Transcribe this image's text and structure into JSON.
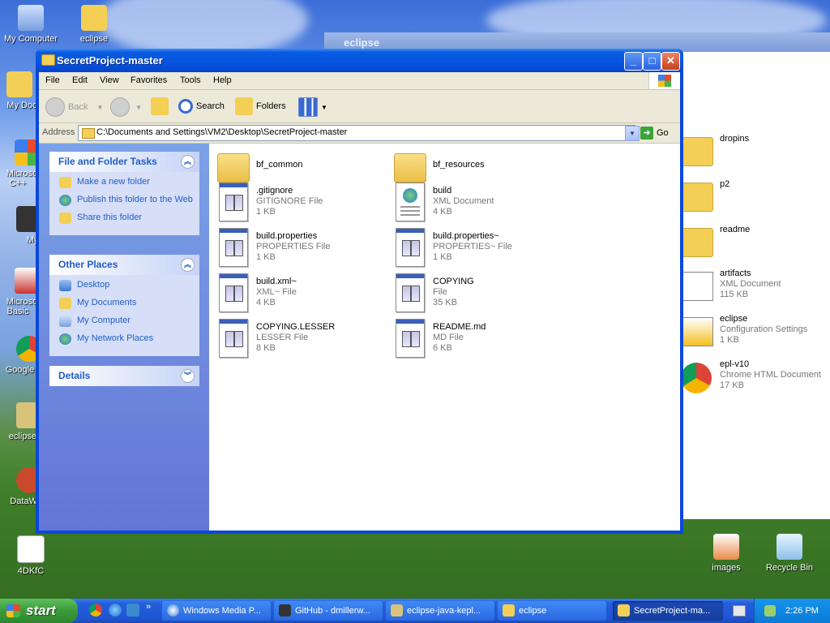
{
  "desktop": {
    "icons_left": [
      "My Computer",
      "eclipse",
      "My Docu",
      "Microsoft C++",
      "Myp",
      "Microsoft Basic",
      "Google C",
      "eclipse-ja",
      "DataWa",
      "4DKfC"
    ],
    "icons_right": [
      "images",
      "Recycle Bin"
    ]
  },
  "background_window": {
    "title": "eclipse",
    "items": [
      {
        "name": "dropins",
        "type": "",
        "size": ""
      },
      {
        "name": "p2",
        "type": "",
        "size": ""
      },
      {
        "name": "readme",
        "type": "",
        "size": ""
      },
      {
        "name": "artifacts",
        "type": "XML Document",
        "size": "115 KB"
      },
      {
        "name": "eclipse",
        "type": "Configuration Settings",
        "size": "1 KB"
      },
      {
        "name": "epl-v10",
        "type": "Chrome HTML Document",
        "size": "17 KB"
      }
    ]
  },
  "window": {
    "title": "SecretProject-master",
    "controls": {
      "minimize": "_",
      "maximize": "□",
      "close": "✕"
    }
  },
  "menubar": [
    "File",
    "Edit",
    "View",
    "Favorites",
    "Tools",
    "Help"
  ],
  "toolbar": {
    "back": "Back",
    "search": "Search",
    "folders": "Folders"
  },
  "address": {
    "label": "Address",
    "value": "C:\\Documents and Settings\\VM2\\Desktop\\SecretProject-master",
    "go": "Go"
  },
  "left_pane": {
    "file_tasks": {
      "title": "File and Folder Tasks",
      "links": [
        "Make a new folder",
        "Publish this folder to the Web",
        "Share this folder"
      ]
    },
    "other_places": {
      "title": "Other Places",
      "links": [
        "Desktop",
        "My Documents",
        "My Computer",
        "My Network Places"
      ]
    },
    "details": {
      "title": "Details"
    }
  },
  "files": [
    {
      "name": "bf_common",
      "type": "",
      "size": "",
      "kind": "folder"
    },
    {
      "name": "bf_resources",
      "type": "",
      "size": "",
      "kind": "folder"
    },
    {
      "name": ".gitignore",
      "type": "GITIGNORE File",
      "size": "1 KB",
      "kind": "file"
    },
    {
      "name": "build",
      "type": "XML Document",
      "size": "4 KB",
      "kind": "xml"
    },
    {
      "name": "build.properties",
      "type": "PROPERTIES File",
      "size": "1 KB",
      "kind": "file"
    },
    {
      "name": "build.properties~",
      "type": "PROPERTIES~ File",
      "size": "1 KB",
      "kind": "file"
    },
    {
      "name": "build.xml~",
      "type": "XML~ File",
      "size": "4 KB",
      "kind": "file"
    },
    {
      "name": "COPYING",
      "type": "File",
      "size": "35 KB",
      "kind": "file"
    },
    {
      "name": "COPYING.LESSER",
      "type": "LESSER File",
      "size": "8 KB",
      "kind": "file"
    },
    {
      "name": "README.md",
      "type": "MD File",
      "size": "6 KB",
      "kind": "file"
    }
  ],
  "taskbar": {
    "start": "start",
    "tasks": [
      "Windows Media P...",
      "GitHub - dmillerw...",
      "eclipse-java-kepl...",
      "eclipse",
      "SecretProject-ma..."
    ],
    "clock": "2:26 PM"
  },
  "colors": {
    "xp_blue": "#0553e0",
    "link_blue": "#215dc6",
    "start_green": "#3a9a3a"
  }
}
